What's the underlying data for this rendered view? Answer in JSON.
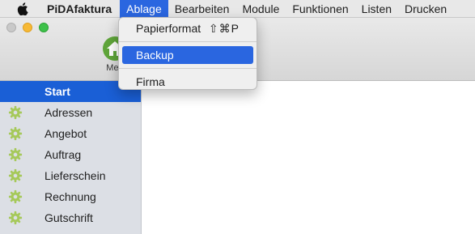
{
  "menubar": {
    "app_name": "PiDAfaktura",
    "menus": [
      "Ablage",
      "Bearbeiten",
      "Module",
      "Funktionen",
      "Listen",
      "Drucken"
    ],
    "active_menu": "Ablage"
  },
  "toolbar": {
    "menu_label": "Men"
  },
  "dropdown": {
    "items": [
      {
        "label": "Papierformat",
        "shortcut": "⇧⌘P"
      },
      {
        "label": "Backup"
      },
      {
        "label": "Firma"
      }
    ],
    "highlighted": "Backup"
  },
  "sidebar": {
    "items": [
      {
        "label": "Start"
      },
      {
        "label": "Adressen"
      },
      {
        "label": "Angebot"
      },
      {
        "label": "Auftrag"
      },
      {
        "label": "Lieferschein"
      },
      {
        "label": "Rechnung"
      },
      {
        "label": "Gutschrift"
      }
    ],
    "selected": "Start"
  },
  "colors": {
    "menu_highlight": "#2a66e0",
    "sidebar_selected": "#1a5fd6",
    "gear": "#9cc14a"
  }
}
